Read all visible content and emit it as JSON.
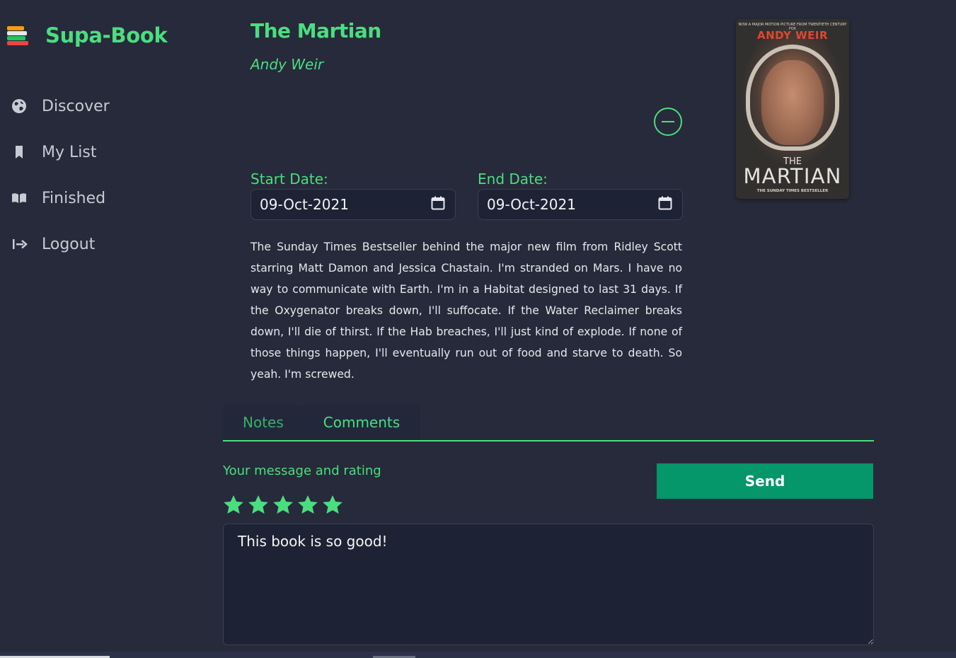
{
  "brand": {
    "title": "Supa-Book",
    "icon": "books-stack-icon"
  },
  "sidebar": {
    "items": [
      {
        "label": "Discover",
        "icon": "globe-icon"
      },
      {
        "label": "My List",
        "icon": "bookmark-icon"
      },
      {
        "label": "Finished",
        "icon": "open-book-icon"
      },
      {
        "label": "Logout",
        "icon": "logout-icon"
      }
    ]
  },
  "book": {
    "title": "The Martian",
    "author": "Andy Weir",
    "cover": {
      "top_text": "NOW A MAJOR MOTION PICTURE FROM TWENTIETH CENTURY FOX",
      "author": "ANDY WEIR",
      "the": "THE",
      "title": "MARTIAN",
      "subtitle": "THE SUNDAY TIMES BESTSELLER"
    },
    "description": "The Sunday Times Bestseller behind the major new film from Ridley Scott starring Matt Damon and Jessica Chastain. I'm stranded on Mars. I have no way to communicate with Earth. I'm in a Habitat designed to last 31 days. If the Oxygenator breaks down, I'll suffocate. If the Water Reclaimer breaks down, I'll die of thirst. If the Hab breaches, I'll just kind of explode. If none of those things happen, I'll eventually run out of food and starve to death. So yeah. I'm screwed."
  },
  "dates": {
    "start_label": "Start Date:",
    "start_value": "09-Oct-2021",
    "end_label": "End Date:",
    "end_value": "09-Oct-2021"
  },
  "tabs": [
    {
      "label": "Notes"
    },
    {
      "label": "Comments"
    }
  ],
  "comment_form": {
    "label": "Your message and rating",
    "rating": 5,
    "max_rating": 5,
    "message": "This book is so good!",
    "send_label": "Send"
  },
  "colors": {
    "accent": "#4ade80",
    "send_button": "#059669",
    "background": "#272a3a",
    "input_background": "#1d2334"
  }
}
